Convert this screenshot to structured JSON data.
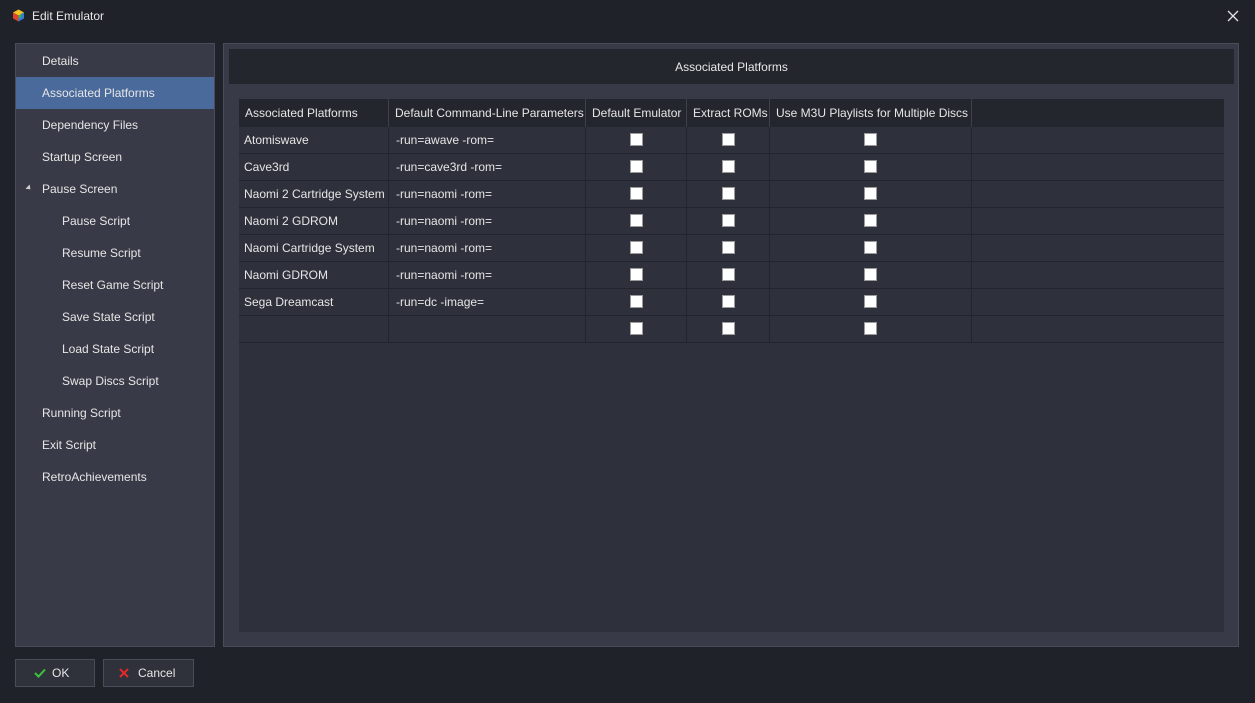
{
  "window": {
    "title": "Edit Emulator",
    "close_glyph": "✕",
    "icon": "launchbox-cube-icon"
  },
  "sidebar": {
    "items": [
      {
        "label": "Details",
        "name": "sidebar-item-details",
        "level": 0,
        "selected": false
      },
      {
        "label": "Associated Platforms",
        "name": "sidebar-item-associated-platforms",
        "level": 0,
        "selected": true
      },
      {
        "label": "Dependency Files",
        "name": "sidebar-item-dependency-files",
        "level": 0,
        "selected": false
      },
      {
        "label": "Startup Screen",
        "name": "sidebar-item-startup-screen",
        "level": 0,
        "selected": false
      },
      {
        "label": "Pause Screen",
        "name": "sidebar-item-pause-screen",
        "level": 0,
        "selected": false,
        "expanded": true
      },
      {
        "label": "Pause Script",
        "name": "sidebar-item-pause-script",
        "level": 1,
        "selected": false
      },
      {
        "label": "Resume Script",
        "name": "sidebar-item-resume-script",
        "level": 1,
        "selected": false
      },
      {
        "label": "Reset Game Script",
        "name": "sidebar-item-reset-game-script",
        "level": 1,
        "selected": false
      },
      {
        "label": "Save State Script",
        "name": "sidebar-item-save-state-script",
        "level": 1,
        "selected": false
      },
      {
        "label": "Load State Script",
        "name": "sidebar-item-load-state-script",
        "level": 1,
        "selected": false
      },
      {
        "label": "Swap Discs Script",
        "name": "sidebar-item-swap-discs-script",
        "level": 1,
        "selected": false
      },
      {
        "label": "Running Script",
        "name": "sidebar-item-running-script",
        "level": 0,
        "selected": false
      },
      {
        "label": "Exit Script",
        "name": "sidebar-item-exit-script",
        "level": 0,
        "selected": false
      },
      {
        "label": "RetroAchievements",
        "name": "sidebar-item-retroachievements",
        "level": 0,
        "selected": false
      }
    ]
  },
  "main": {
    "header": "Associated Platforms",
    "columns": [
      "Associated Platforms",
      "Default Command-Line Parameters",
      "Default Emulator",
      "Extract ROMs",
      "Use M3U Playlists for Multiple Discs"
    ],
    "rows": [
      {
        "platform": "Atomiswave",
        "params": "-run=awave -rom=",
        "default_emulator": false,
        "extract_roms": false,
        "use_m3u": false
      },
      {
        "platform": "Cave3rd",
        "params": "-run=cave3rd -rom=",
        "default_emulator": false,
        "extract_roms": false,
        "use_m3u": false
      },
      {
        "platform": "Naomi 2 Cartridge System",
        "params": "-run=naomi -rom=",
        "default_emulator": false,
        "extract_roms": false,
        "use_m3u": false
      },
      {
        "platform": "Naomi 2 GDROM",
        "params": "-run=naomi -rom=",
        "default_emulator": false,
        "extract_roms": false,
        "use_m3u": false
      },
      {
        "platform": "Naomi Cartridge System",
        "params": "-run=naomi -rom=",
        "default_emulator": false,
        "extract_roms": false,
        "use_m3u": false
      },
      {
        "platform": "Naomi GDROM",
        "params": "-run=naomi -rom=",
        "default_emulator": false,
        "extract_roms": false,
        "use_m3u": false
      },
      {
        "platform": "Sega Dreamcast",
        "params": "-run=dc -image=",
        "default_emulator": false,
        "extract_roms": false,
        "use_m3u": false
      },
      {
        "platform": "",
        "params": "",
        "default_emulator": false,
        "extract_roms": false,
        "use_m3u": false
      }
    ]
  },
  "footer": {
    "ok_label": "OK",
    "ok_icon": "checkmark-icon",
    "ok_color": "#3cc43c",
    "cancel_label": "Cancel",
    "cancel_icon": "cancel-x-icon",
    "cancel_color": "#e02a2a"
  },
  "colors": {
    "background": "#202229",
    "panel": "#383b47",
    "selected": "#4a6a9c",
    "grid_background": "#2e313b",
    "header_background": "#24262e"
  }
}
